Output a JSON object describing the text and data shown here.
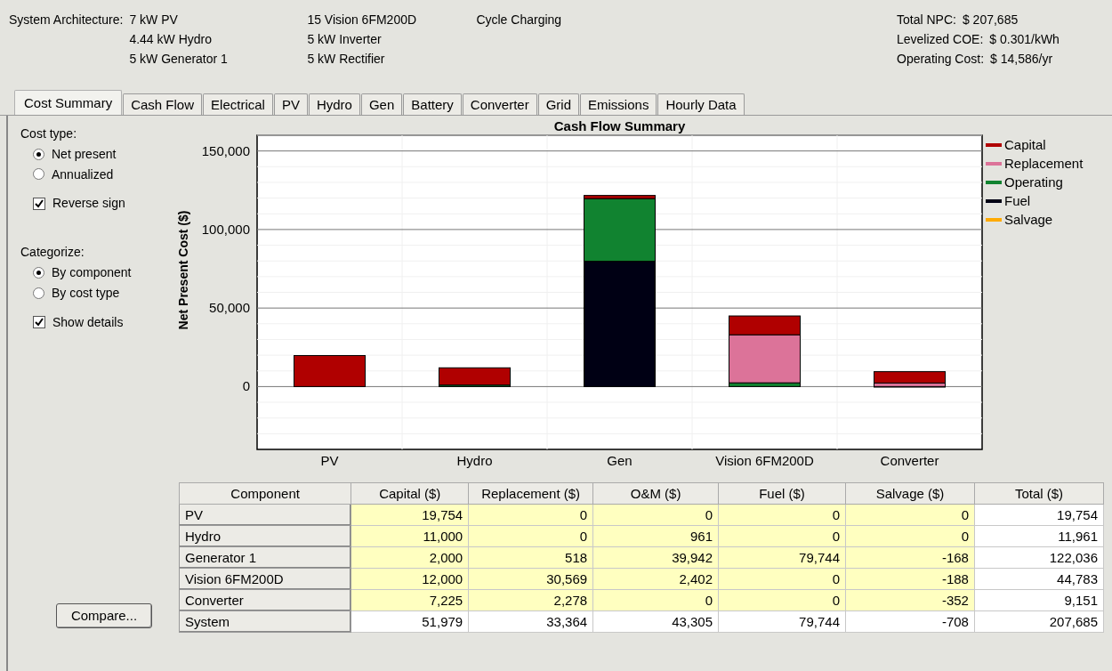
{
  "architecture": {
    "label": "System Architecture:",
    "columns": [
      [
        "7 kW PV",
        "4.44 kW Hydro",
        "5 kW Generator 1"
      ],
      [
        "15 Vision 6FM200D",
        "5 kW Inverter",
        "5 kW Rectifier"
      ],
      [
        "Cycle Charging"
      ]
    ]
  },
  "metrics": [
    {
      "label": "Total NPC:",
      "value": "$ 207,685"
    },
    {
      "label": "Levelized COE:",
      "value": "$ 0.301/kWh"
    },
    {
      "label": "Operating Cost:",
      "value": "$ 14,586/yr"
    }
  ],
  "tabs": [
    {
      "label": "Cost Summary",
      "selected": true
    },
    {
      "label": "Cash Flow",
      "selected": false
    },
    {
      "label": "Electrical",
      "selected": false
    },
    {
      "label": "PV",
      "selected": false
    },
    {
      "label": "Hydro",
      "selected": false
    },
    {
      "label": "Gen",
      "selected": false
    },
    {
      "label": "Battery",
      "selected": false
    },
    {
      "label": "Converter",
      "selected": false
    },
    {
      "label": "Grid",
      "selected": false
    },
    {
      "label": "Emissions",
      "selected": false
    },
    {
      "label": "Hourly Data",
      "selected": false
    }
  ],
  "options": [
    {
      "heading": "Cost type:",
      "items": [
        {
          "kind": "radio",
          "label": "Net present",
          "selected": true
        },
        {
          "kind": "radio",
          "label": "Annualized",
          "selected": false
        },
        {
          "kind": "checkbox",
          "label": "Reverse sign",
          "checked": true
        }
      ]
    },
    {
      "heading": "Categorize:",
      "items": [
        {
          "kind": "radio",
          "label": "By component",
          "selected": true
        },
        {
          "kind": "radio",
          "label": "By cost type",
          "selected": false
        },
        {
          "kind": "checkbox",
          "label": "Show details",
          "checked": true
        }
      ]
    }
  ],
  "compare_button": "Compare...",
  "chart": {
    "chart_data": {
      "type": "bar",
      "title": "Cash Flow Summary",
      "ylabel": "Net Present Cost ($)",
      "stacked": true,
      "grid": true,
      "legend": "right",
      "categories": [
        "PV",
        "Hydro",
        "Gen",
        "Vision 6FM200D",
        "Converter"
      ],
      "ylim": [
        -40000,
        160000
      ],
      "yticks": [
        {
          "value": 0,
          "label": "0"
        },
        {
          "value": 50000,
          "label": "50,000"
        },
        {
          "value": 100000,
          "label": "100,000"
        },
        {
          "value": 150000,
          "label": "150,000"
        }
      ],
      "series": [
        {
          "name": "Salvage",
          "color": "#ffaa00",
          "values": [
            0,
            0,
            null,
            null,
            -352
          ]
        },
        {
          "name": "Fuel",
          "color": "#000014",
          "values": [
            0,
            0,
            79744,
            0,
            0
          ]
        },
        {
          "name": "Operating",
          "color": "#118330",
          "values": [
            0,
            961,
            39942,
            2402,
            0
          ]
        },
        {
          "name": "Replacement",
          "color": "#dc7399",
          "values": [
            0,
            0,
            null,
            30569,
            2278
          ]
        },
        {
          "name": "Capital",
          "color": "#b00000",
          "values": [
            19754,
            11000,
            2000,
            12000,
            7225
          ]
        }
      ]
    }
  },
  "table": {
    "columns": [
      "Component",
      "Capital ($)",
      "Replacement ($)",
      "O&M ($)",
      "Fuel ($)",
      "Salvage ($)",
      "Total ($)"
    ],
    "rows": [
      {
        "kind": "component",
        "cells": [
          "PV",
          "19,754",
          "0",
          "0",
          "0",
          "0",
          "19,754"
        ]
      },
      {
        "kind": "component",
        "cells": [
          "Hydro",
          "11,000",
          "0",
          "961",
          "0",
          "0",
          "11,961"
        ]
      },
      {
        "kind": "component",
        "cells": [
          "Generator 1",
          "2,000",
          "518",
          "39,942",
          "79,744",
          "-168",
          "122,036"
        ]
      },
      {
        "kind": "component",
        "cells": [
          "Vision 6FM200D",
          "12,000",
          "30,569",
          "2,402",
          "0",
          "-188",
          "44,783"
        ]
      },
      {
        "kind": "component",
        "cells": [
          "Converter",
          "7,225",
          "2,278",
          "0",
          "0",
          "-352",
          "9,151"
        ]
      },
      {
        "kind": "total",
        "cells": [
          "System",
          "51,979",
          "33,364",
          "43,305",
          "79,744",
          "-708",
          "207,685"
        ]
      }
    ]
  }
}
